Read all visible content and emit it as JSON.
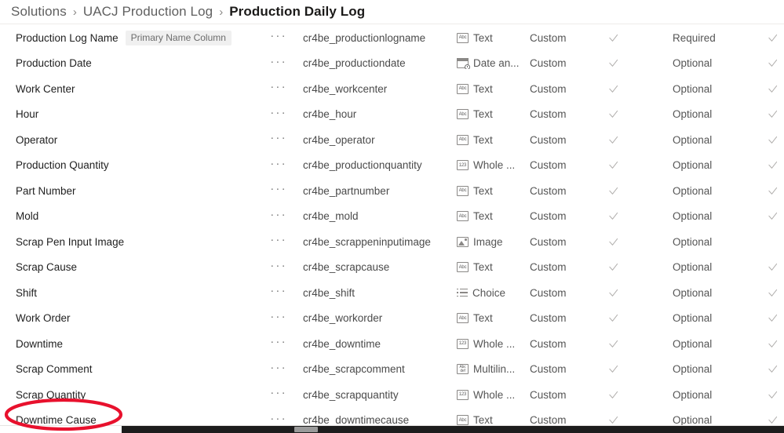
{
  "breadcrumb": {
    "separator": "›",
    "items": [
      {
        "label": "Solutions",
        "current": false
      },
      {
        "label": "UACJ Production Log",
        "current": false
      },
      {
        "label": "Production Daily Log",
        "current": true
      }
    ]
  },
  "grid": {
    "row_menu_glyph": "···",
    "primary_pill": "Primary Name Column",
    "rows": [
      {
        "display_name": "Production Log Name",
        "pill": "Primary Name Column",
        "logical_name": "cr4be_productionlogname",
        "data_type": "Text",
        "type_icon": "text-icon",
        "type_glyph": "Abc",
        "customization": "Custom",
        "check1": true,
        "requirement": "Required",
        "check2": true
      },
      {
        "display_name": "Production Date",
        "pill": "",
        "logical_name": "cr4be_productiondate",
        "data_type": "Date an...",
        "type_icon": "date-time-icon",
        "type_glyph": "",
        "customization": "Custom",
        "check1": true,
        "requirement": "Optional",
        "check2": true
      },
      {
        "display_name": "Work Center",
        "pill": "",
        "logical_name": "cr4be_workcenter",
        "data_type": "Text",
        "type_icon": "text-icon",
        "type_glyph": "Abc",
        "customization": "Custom",
        "check1": true,
        "requirement": "Optional",
        "check2": true
      },
      {
        "display_name": "Hour",
        "pill": "",
        "logical_name": "cr4be_hour",
        "data_type": "Text",
        "type_icon": "text-icon",
        "type_glyph": "Abc",
        "customization": "Custom",
        "check1": true,
        "requirement": "Optional",
        "check2": true
      },
      {
        "display_name": "Operator",
        "pill": "",
        "logical_name": "cr4be_operator",
        "data_type": "Text",
        "type_icon": "text-icon",
        "type_glyph": "Abc",
        "customization": "Custom",
        "check1": true,
        "requirement": "Optional",
        "check2": true
      },
      {
        "display_name": "Production Quantity",
        "pill": "",
        "logical_name": "cr4be_productionquantity",
        "data_type": "Whole ...",
        "type_icon": "whole-number-icon",
        "type_glyph": "123",
        "customization": "Custom",
        "check1": true,
        "requirement": "Optional",
        "check2": true
      },
      {
        "display_name": "Part Number",
        "pill": "",
        "logical_name": "cr4be_partnumber",
        "data_type": "Text",
        "type_icon": "text-icon",
        "type_glyph": "Abc",
        "customization": "Custom",
        "check1": true,
        "requirement": "Optional",
        "check2": true
      },
      {
        "display_name": "Mold",
        "pill": "",
        "logical_name": "cr4be_mold",
        "data_type": "Text",
        "type_icon": "text-icon",
        "type_glyph": "Abc",
        "customization": "Custom",
        "check1": true,
        "requirement": "Optional",
        "check2": true
      },
      {
        "display_name": "Scrap Pen Input Image",
        "pill": "",
        "logical_name": "cr4be_scrappeninputimage",
        "data_type": "Image",
        "type_icon": "image-icon",
        "type_glyph": "",
        "customization": "Custom",
        "check1": true,
        "requirement": "Optional",
        "check2": false
      },
      {
        "display_name": "Scrap Cause",
        "pill": "",
        "logical_name": "cr4be_scrapcause",
        "data_type": "Text",
        "type_icon": "text-icon",
        "type_glyph": "Abc",
        "customization": "Custom",
        "check1": true,
        "requirement": "Optional",
        "check2": true
      },
      {
        "display_name": "Shift",
        "pill": "",
        "logical_name": "cr4be_shift",
        "data_type": "Choice",
        "type_icon": "choice-icon",
        "type_glyph": "",
        "customization": "Custom",
        "check1": true,
        "requirement": "Optional",
        "check2": true
      },
      {
        "display_name": "Work Order",
        "pill": "",
        "logical_name": "cr4be_workorder",
        "data_type": "Text",
        "type_icon": "text-icon",
        "type_glyph": "Abc",
        "customization": "Custom",
        "check1": true,
        "requirement": "Optional",
        "check2": true
      },
      {
        "display_name": "Downtime",
        "pill": "",
        "logical_name": "cr4be_downtime",
        "data_type": "Whole ...",
        "type_icon": "whole-number-icon",
        "type_glyph": "123",
        "customization": "Custom",
        "check1": true,
        "requirement": "Optional",
        "check2": true
      },
      {
        "display_name": "Scrap Comment",
        "pill": "",
        "logical_name": "cr4be_scrapcomment",
        "data_type": "Multilin...",
        "type_icon": "multiline-text-icon",
        "type_glyph": "Abc",
        "customization": "Custom",
        "check1": true,
        "requirement": "Optional",
        "check2": true
      },
      {
        "display_name": "Scrap Quantity",
        "pill": "",
        "logical_name": "cr4be_scrapquantity",
        "data_type": "Whole ...",
        "type_icon": "whole-number-icon",
        "type_glyph": "123",
        "customization": "Custom",
        "check1": true,
        "requirement": "Optional",
        "check2": true
      },
      {
        "display_name": "Downtime Cause",
        "pill": "",
        "logical_name": "cr4be_downtimecause",
        "data_type": "Text",
        "type_icon": "text-icon",
        "type_glyph": "Abc",
        "customization": "Custom",
        "check1": true,
        "requirement": "Optional",
        "check2": true
      }
    ]
  },
  "annotation": {
    "shape": "ellipse",
    "color": "#E8112D",
    "targets": "Downtime Cause"
  },
  "scrollbar": {
    "orientation": "horizontal",
    "track_color": "#1d1d1d",
    "thumb_color": "#9a9a9a"
  }
}
